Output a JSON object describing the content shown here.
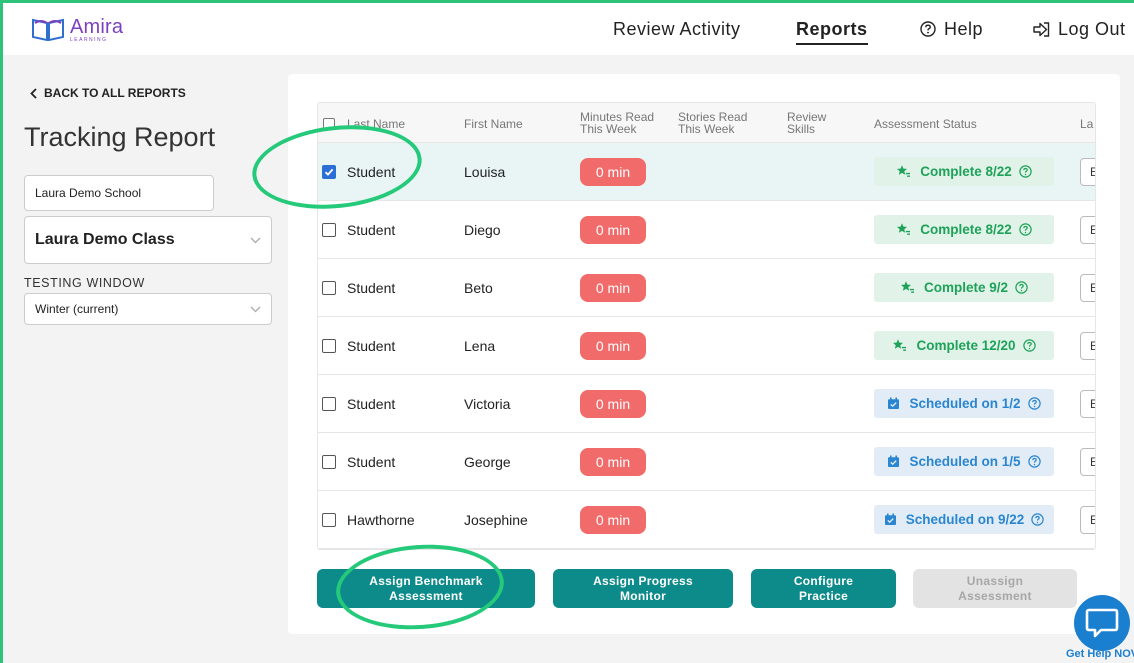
{
  "header": {
    "logo_name": "Amira",
    "logo_sub": "LEARNING",
    "nav": {
      "review_activity": "Review Activity",
      "reports": "Reports",
      "help": "Help",
      "logout": "Log Out"
    }
  },
  "sidebar": {
    "back_link": "BACK TO ALL REPORTS",
    "title": "Tracking Report",
    "school": "Laura Demo School",
    "class": "Laura Demo Class",
    "testing_window_label": "TESTING WINDOW",
    "testing_window_value": "Winter (current)"
  },
  "table": {
    "columns": {
      "last_name": "Last Name",
      "first_name": "First Name",
      "minutes_read": [
        "Minutes Read",
        "This Week"
      ],
      "stories_read": [
        "Stories Read",
        "This Week"
      ],
      "review_skills": [
        "Review",
        "Skills"
      ],
      "assessment_status": "Assessment Status",
      "truncated": "La"
    },
    "rows": [
      {
        "last": "Student",
        "first": "Louisa",
        "minutes": "0 min",
        "status": "Complete 8/22",
        "status_type": "complete",
        "checked": true,
        "trunc": "E"
      },
      {
        "last": "Student",
        "first": "Diego",
        "minutes": "0 min",
        "status": "Complete 8/22",
        "status_type": "complete",
        "checked": false,
        "trunc": "E"
      },
      {
        "last": "Student",
        "first": "Beto",
        "minutes": "0 min",
        "status": "Complete 9/2",
        "status_type": "complete",
        "checked": false,
        "trunc": "E"
      },
      {
        "last": "Student",
        "first": "Lena",
        "minutes": "0 min",
        "status": "Complete 12/20",
        "status_type": "complete",
        "checked": false,
        "trunc": "E"
      },
      {
        "last": "Student",
        "first": "Victoria",
        "minutes": "0 min",
        "status": "Scheduled on 1/2",
        "status_type": "scheduled",
        "checked": false,
        "trunc": "E"
      },
      {
        "last": "Student",
        "first": "George",
        "minutes": "0 min",
        "status": "Scheduled on 1/5",
        "status_type": "scheduled",
        "checked": false,
        "trunc": "E"
      },
      {
        "last": "Hawthorne",
        "first": "Josephine",
        "minutes": "0 min",
        "status": "Scheduled on 9/22",
        "status_type": "scheduled",
        "checked": false,
        "trunc": "E"
      }
    ]
  },
  "actions": {
    "assign_benchmark": [
      "Assign Benchmark",
      "Assessment"
    ],
    "assign_progress": [
      "Assign Progress",
      "Monitor"
    ],
    "configure_practice": [
      "Configure",
      "Practice"
    ],
    "unassign": [
      "Unassign",
      "Assessment"
    ]
  },
  "help_chat": {
    "label": "Get Help NOV"
  },
  "colors": {
    "accent_teal": "#0d8a8a",
    "minutes_red": "#f26b6b",
    "complete_green": "#1ea25a",
    "scheduled_blue": "#2a86d0",
    "annotation_green": "#25c97a"
  }
}
